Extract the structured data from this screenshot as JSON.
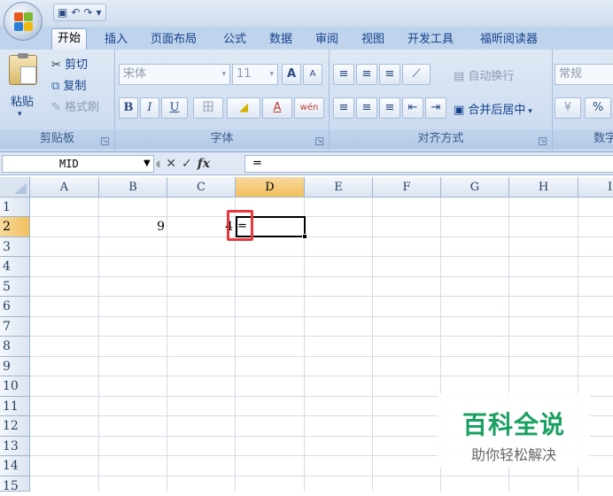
{
  "qat": {
    "save": "▣",
    "undo": "↶",
    "redo": "↷",
    "more": "▾"
  },
  "tabs": [
    "开始",
    "插入",
    "页面布局",
    "公式",
    "数据",
    "审阅",
    "视图",
    "开发工具",
    "福昕阅读器"
  ],
  "ribbon": {
    "clipboard": {
      "paste": "粘贴",
      "cut": "剪切",
      "copy": "复制",
      "format_painter": "格式刷",
      "label": "剪贴板"
    },
    "font": {
      "font_name": "宋体",
      "font_size": "11",
      "grow": "A",
      "shrink": "A",
      "bold": "B",
      "italic": "I",
      "underline": "U",
      "border": "田",
      "fill": "◢",
      "color": "A",
      "phonetic": "wén",
      "label": "字体"
    },
    "alignment": {
      "wrap": "自动换行",
      "merge": "合并后居中",
      "label": "对齐方式"
    },
    "number": {
      "format": "常规",
      "percent": "%",
      "label": "数字"
    }
  },
  "formula_bar": {
    "name_box": "MID",
    "cancel": "✕",
    "enter": "✓",
    "fx": "fx",
    "content": "="
  },
  "columns": [
    "A",
    "B",
    "C",
    "D",
    "E",
    "F",
    "G",
    "H",
    "I"
  ],
  "rows": [
    "1",
    "2",
    "3",
    "4",
    "5",
    "6",
    "7",
    "8",
    "9",
    "10",
    "11",
    "12",
    "13",
    "14",
    "15"
  ],
  "cells": {
    "B2": "9",
    "C2": "4",
    "D2": "="
  },
  "watermark": {
    "title": "百科全说",
    "subtitle": "助你轻松解决"
  },
  "colors": {
    "accent": "#e8383d",
    "watermark": "#1aa061",
    "selected_header": "#f1c05c"
  }
}
